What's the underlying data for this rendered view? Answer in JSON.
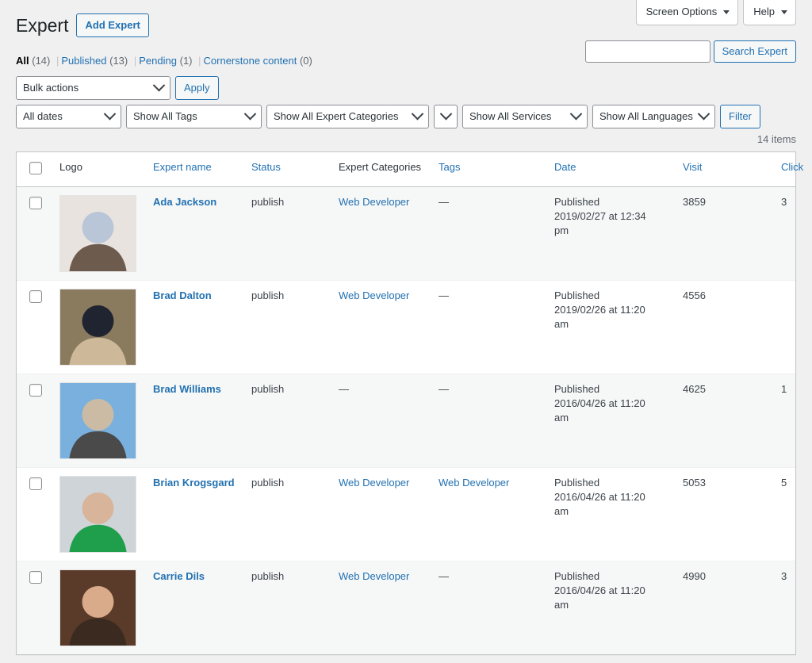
{
  "screen_meta": {
    "screen_options_label": "Screen Options",
    "help_label": "Help"
  },
  "header": {
    "title": "Expert",
    "add_new_label": "Add Expert"
  },
  "search": {
    "value": "",
    "placeholder": "",
    "button_label": "Search Expert"
  },
  "status_links": [
    {
      "label": "All",
      "count": "(14)",
      "current": true
    },
    {
      "label": "Published",
      "count": "(13)",
      "current": false
    },
    {
      "label": "Pending",
      "count": "(1)",
      "current": false
    },
    {
      "label": "Cornerstone content",
      "count": "(0)",
      "current": false
    }
  ],
  "toolbar": {
    "bulk_actions_label": "Bulk actions",
    "apply_label": "Apply",
    "all_dates_label": "All dates",
    "all_tags_label": "Show All Tags",
    "all_expert_categories_label": "Show All Expert Categories",
    "narrow_select_label": "",
    "all_services_label": "Show All Services",
    "all_languages_label": "Show All Languages",
    "filter_label": "Filter",
    "displaying_num": "14 items"
  },
  "table": {
    "columns": [
      {
        "key": "cb",
        "label": "",
        "link": false
      },
      {
        "key": "logo",
        "label": "Logo",
        "link": false
      },
      {
        "key": "name",
        "label": "Expert name",
        "link": true
      },
      {
        "key": "status",
        "label": "Status",
        "link": true
      },
      {
        "key": "cats",
        "label": "Expert Categories",
        "link": false
      },
      {
        "key": "tags",
        "label": "Tags",
        "link": true
      },
      {
        "key": "date",
        "label": "Date",
        "link": true
      },
      {
        "key": "visit",
        "label": "Visit",
        "link": true
      },
      {
        "key": "click",
        "label": "Click",
        "link": true
      }
    ],
    "rows": [
      {
        "name": "Ada Jackson",
        "status": "publish",
        "categories": "Web Developer",
        "categories_is_link": true,
        "tags": "—",
        "tags_is_link": false,
        "date_status": "Published",
        "date_value": "2019/02/27 at 12:34",
        "date_meridiem": "pm",
        "visit": "3859",
        "click": "3",
        "avatar_colors": [
          "#e8e3df",
          "#b9c6d8",
          "#6d5b4e"
        ]
      },
      {
        "name": "Brad Dalton",
        "status": "publish",
        "categories": "Web Developer",
        "categories_is_link": true,
        "tags": "—",
        "tags_is_link": false,
        "date_status": "Published",
        "date_value": "2019/02/26 at 11:20",
        "date_meridiem": "am",
        "visit": "4556",
        "click": "",
        "avatar_colors": [
          "#8a7a5e",
          "#1f2430",
          "#cdb89a"
        ]
      },
      {
        "name": "Brad Williams",
        "status": "publish",
        "categories": "—",
        "categories_is_link": false,
        "tags": "—",
        "tags_is_link": false,
        "date_status": "Published",
        "date_value": "2016/04/26 at 11:20",
        "date_meridiem": "am",
        "visit": "4625",
        "click": "1",
        "avatar_colors": [
          "#7ab0dd",
          "#cbbba4",
          "#4a4a4a"
        ]
      },
      {
        "name": "Brian Krogsgard",
        "status": "publish",
        "categories": "Web Developer",
        "categories_is_link": true,
        "tags": "Web Developer",
        "tags_is_link": true,
        "date_status": "Published",
        "date_value": "2016/04/26 at 11:20",
        "date_meridiem": "am",
        "visit": "5053",
        "click": "5",
        "avatar_colors": [
          "#cfd4d8",
          "#d8b49a",
          "#1f9e4b"
        ]
      },
      {
        "name": "Carrie Dils",
        "status": "publish",
        "categories": "Web Developer",
        "categories_is_link": true,
        "tags": "—",
        "tags_is_link": false,
        "date_status": "Published",
        "date_value": "2016/04/26 at 11:20",
        "date_meridiem": "am",
        "visit": "4990",
        "click": "3",
        "avatar_colors": [
          "#5a3a28",
          "#d9ab8a",
          "#3a2a20"
        ]
      }
    ]
  }
}
